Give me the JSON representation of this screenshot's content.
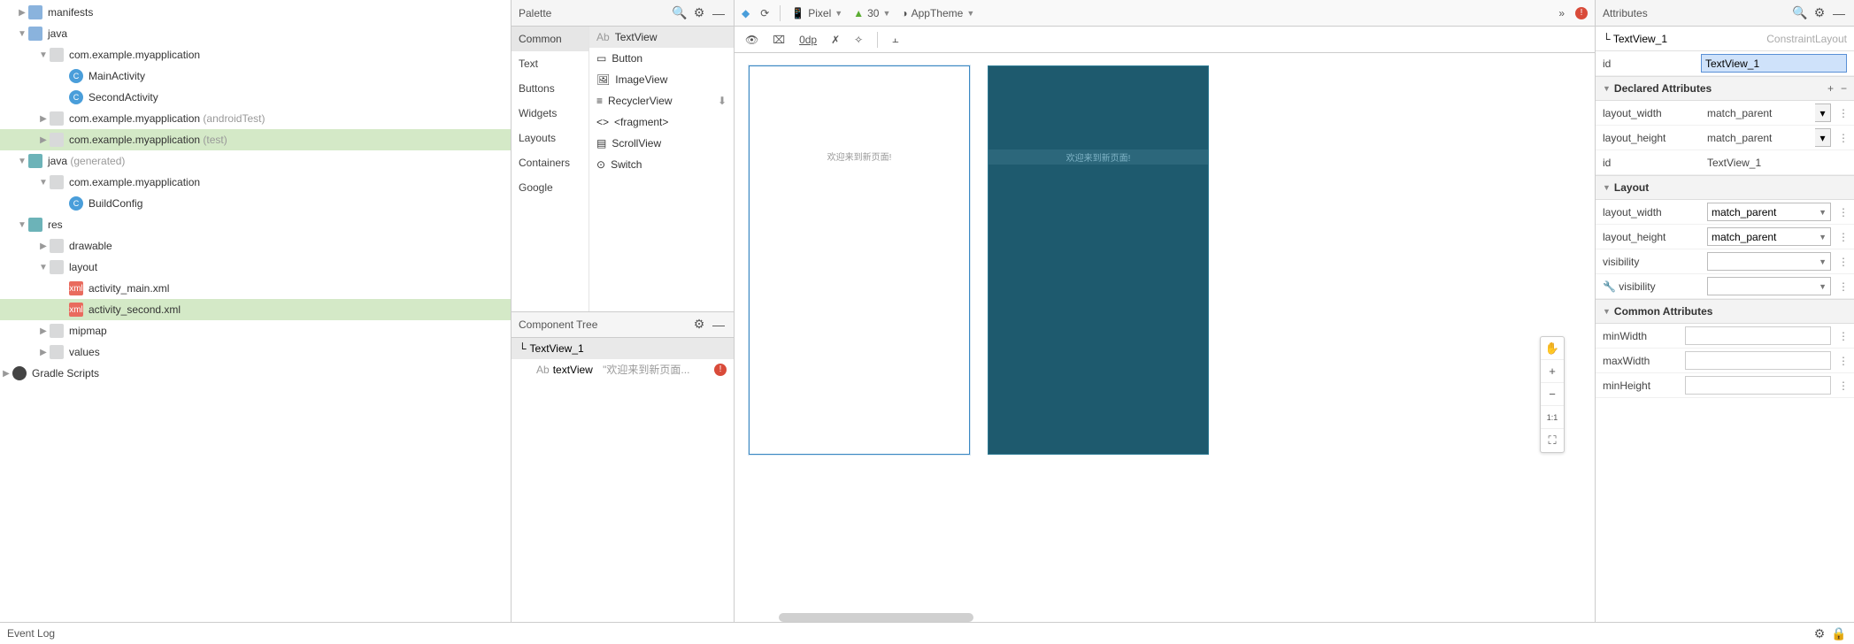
{
  "tree": {
    "manifests": "manifests",
    "java": "java",
    "pkg": "com.example.myapplication",
    "main_activity": "MainActivity",
    "second_activity": "SecondActivity",
    "android_test": "com.example.myapplication",
    "android_test_suffix": "(androidTest)",
    "unit_test": "com.example.myapplication",
    "unit_test_suffix": "(test)",
    "java_gen": "java",
    "java_gen_suffix": "(generated)",
    "build_config": "BuildConfig",
    "res": "res",
    "drawable": "drawable",
    "layout": "layout",
    "activity_main": "activity_main.xml",
    "activity_second": "activity_second.xml",
    "mipmap": "mipmap",
    "values": "values",
    "gradle": "Gradle Scripts"
  },
  "palette": {
    "title": "Palette",
    "cats": [
      "Common",
      "Text",
      "Buttons",
      "Widgets",
      "Layouts",
      "Containers",
      "Google"
    ],
    "items": [
      "TextView",
      "Button",
      "ImageView",
      "RecyclerView",
      "<fragment>",
      "ScrollView",
      "Switch"
    ]
  },
  "component_tree": {
    "title": "Component Tree",
    "root": "TextView_1",
    "child_name": "textView",
    "child_text": "\"欢迎来到新页面..."
  },
  "design_toolbar": {
    "device": "Pixel",
    "api": "30",
    "theme": "AppTheme",
    "zero_dp": "0dp"
  },
  "canvas_text": "欢迎来到新页面!",
  "attributes": {
    "title": "Attributes",
    "identity": "TextView_1",
    "layout_type": "ConstraintLayout",
    "id_label": "id",
    "id_value": "TextView_1",
    "declared": "Declared Attributes",
    "layout_width_label": "layout_width",
    "layout_width_val": "match_parent",
    "layout_height_label": "layout_height",
    "layout_height_val": "match_parent",
    "layout_section": "Layout",
    "visibility_label": "visibility",
    "tools_visibility_label": "visibility",
    "common_section": "Common Attributes",
    "minWidth": "minWidth",
    "maxWidth": "maxWidth",
    "minHeight": "minHeight"
  },
  "status": {
    "event_log": "Event Log"
  }
}
